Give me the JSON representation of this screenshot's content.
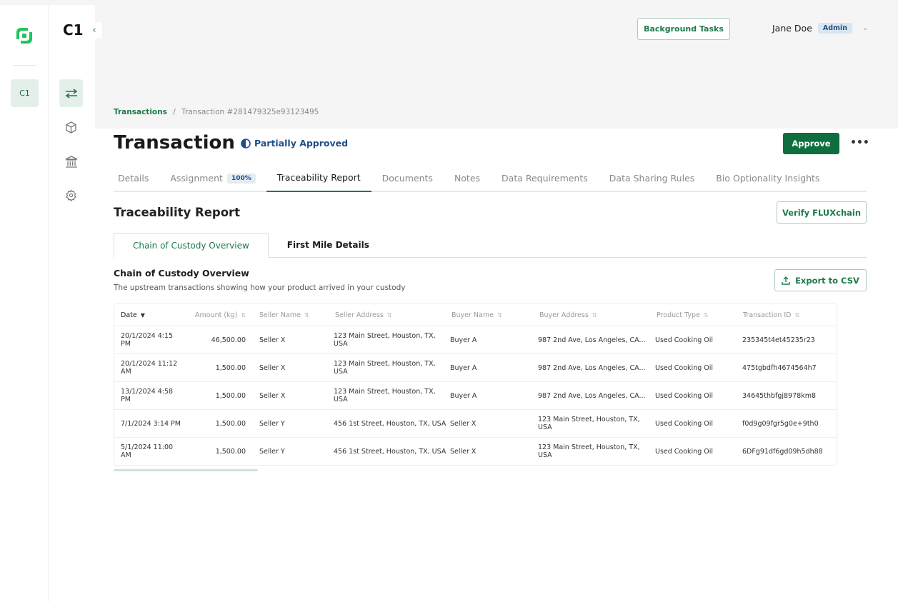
{
  "app": {
    "org_badge": "C1",
    "workspace": "C1",
    "accent": "#0f6e3f",
    "logo_color": "#22c55e"
  },
  "sidebar": {
    "items": [
      {
        "icon": "arrows-swap-icon",
        "active": true
      },
      {
        "icon": "cube-icon"
      },
      {
        "icon": "bank-icon"
      },
      {
        "icon": "gear-icon"
      }
    ]
  },
  "header": {
    "background_tasks": "Background Tasks",
    "user_name": "Jane Doe",
    "role": "Admin"
  },
  "breadcrumb": {
    "root": "Transactions",
    "sep": "/",
    "current": "Transaction #281479325e93123495"
  },
  "page": {
    "title": "Transaction",
    "status": "Partially Approved",
    "approve": "Approve",
    "more": "•••"
  },
  "tabs": [
    {
      "label": "Details"
    },
    {
      "label": "Assignment",
      "badge": "100%"
    },
    {
      "label": "Traceability Report",
      "active": true
    },
    {
      "label": "Documents"
    },
    {
      "label": "Notes"
    },
    {
      "label": "Data Requirements"
    },
    {
      "label": "Data Sharing Rules"
    },
    {
      "label": "Bio Optionality Insights"
    }
  ],
  "report": {
    "title": "Traceability Report",
    "verify": "Verify FLUXchain",
    "subtabs": [
      {
        "label": "Chain of Custody Overview",
        "active": true
      },
      {
        "label": "First Mile Details"
      }
    ],
    "section_title": "Chain of Custody Overview",
    "section_desc": "The upstream transactions showing how your product arrived in your custody",
    "export": "Export to CSV"
  },
  "table": {
    "columns": [
      "Date",
      "Amount (kg)",
      "Seller Name",
      "Seller Address",
      "Buyer Name",
      "Buyer Address",
      "Product Type",
      "Transaction ID"
    ],
    "rows": [
      [
        "20/1/2024 4:15 PM",
        "46,500.00",
        "Seller X",
        "123 Main Street, Houston, TX, USA",
        "Buyer A",
        "987 2nd Ave, Los Angeles, CA...",
        "Used Cooking Oil",
        "235345t4et45235r23"
      ],
      [
        "20/1/2024 11:12 AM",
        "1,500.00",
        "Seller X",
        "123 Main Street, Houston, TX, USA",
        "Buyer A",
        "987 2nd Ave, Los Angeles, CA...",
        "Used Cooking Oil",
        "475tgbdfh4674564h7"
      ],
      [
        "13/1/2024 4:58 PM",
        "1,500.00",
        "Seller X",
        "123 Main Street, Houston, TX, USA",
        "Buyer A",
        "987 2nd Ave, Los Angeles, CA...",
        "Used Cooking Oil",
        "34645thbfgj8978km8"
      ],
      [
        "7/1/2024 3:14 PM",
        "1,500.00",
        "Seller Y",
        "456 1st Street, Houston, TX, USA",
        "Seller X",
        "123 Main Street, Houston, TX, USA",
        "Used Cooking Oil",
        "f0d9g09fgr5g0e+9th0"
      ],
      [
        "5/1/2024 11:00 AM",
        "1,500.00",
        "Seller Y",
        "456 1st Street, Houston, TX, USA",
        "Seller X",
        "123 Main Street, Houston, TX, USA",
        "Used Cooking Oil",
        "6DFg91df6gd09h5dh88"
      ]
    ]
  }
}
